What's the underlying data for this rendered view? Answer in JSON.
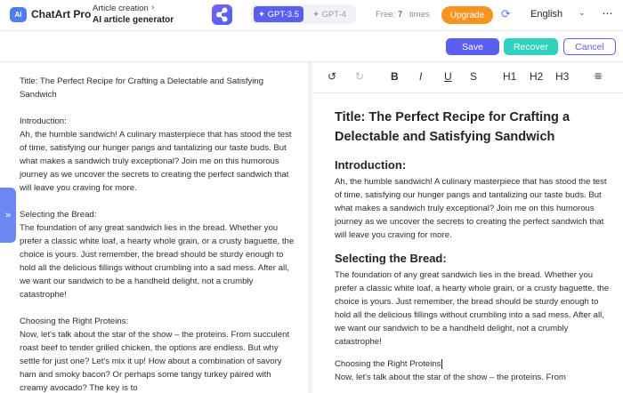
{
  "header": {
    "logo_icon": "AI",
    "brand": "ChatArt Pro",
    "breadcrumb_parent": "Article creation",
    "breadcrumb_current": "AI article generator",
    "models": [
      "GPT-3.5",
      "GPT-4"
    ],
    "free_label": "Free:",
    "free_count": "7",
    "free_unit": "times",
    "upgrade": "Upgrade",
    "language": "English"
  },
  "actions": {
    "save": "Save",
    "recover": "Recover",
    "cancel": "Cancel"
  },
  "toolbar": {
    "undo": "↺",
    "redo": "↻",
    "bold": "B",
    "italic": "I",
    "underline": "U",
    "strike": "S",
    "h1": "H1",
    "h2": "H2",
    "h3": "H3",
    "list": "≡"
  },
  "source_text": {
    "title": "Title: The Perfect Recipe for Crafting a Delectable and Satisfying Sandwich",
    "intro_label": "Introduction:",
    "intro": "Ah, the humble sandwich! A culinary masterpiece that has stood the test of time, satisfying our hunger pangs and tantalizing our taste buds. But what makes a sandwich truly exceptional? Join me on this humorous journey as we uncover the secrets to creating the perfect sandwich that will leave you craving for more.",
    "bread_label": "Selecting the Bread:",
    "bread": "The foundation of any great sandwich lies in the bread. Whether you prefer a classic white loaf, a hearty whole grain, or a crusty baguette, the choice is yours. Just remember, the bread should be sturdy enough to hold all the delicious fillings without crumbling into a sad mess. After all, we want our sandwich to be a handheld delight, not a crumbly catastrophe!",
    "proteins_label": "Choosing the Right Proteins:",
    "proteins": "Now, let's talk about the star of the show – the proteins. From succulent roast beef to tender grilled chicken, the options are endless. But why settle for just one? Let's mix it up! How about a combination of savory ham and smoky bacon? Or perhaps some tangy turkey paired with creamy avocado? The key is to"
  },
  "editor": {
    "title": "Title: The Perfect Recipe for Crafting a Delectable and Satisfying Sandwich",
    "intro_heading": "Introduction:",
    "intro": "Ah, the humble sandwich! A culinary masterpiece that has stood the test of time, satisfying our hunger pangs and tantalizing our taste buds. But what makes a sandwich truly exceptional? Join me on this humorous journey as we uncover the secrets to creating the perfect sandwich that will leave you craving for more.",
    "bread_heading": "Selecting the Bread:",
    "bread": "The foundation of any great sandwich lies in the bread. Whether you prefer a classic white loaf, a hearty whole grain, or a crusty baguette, the choice is yours. Just remember, the bread should be sturdy enough to hold all the delicious fillings without crumbling into a sad mess. After all, we want our sandwich to be a handheld delight, not a crumbly catastrophe!",
    "proteins_label": "Choosing the Right Proteins",
    "proteins": "Now, let's talk about the star of the show – the proteins. From"
  }
}
